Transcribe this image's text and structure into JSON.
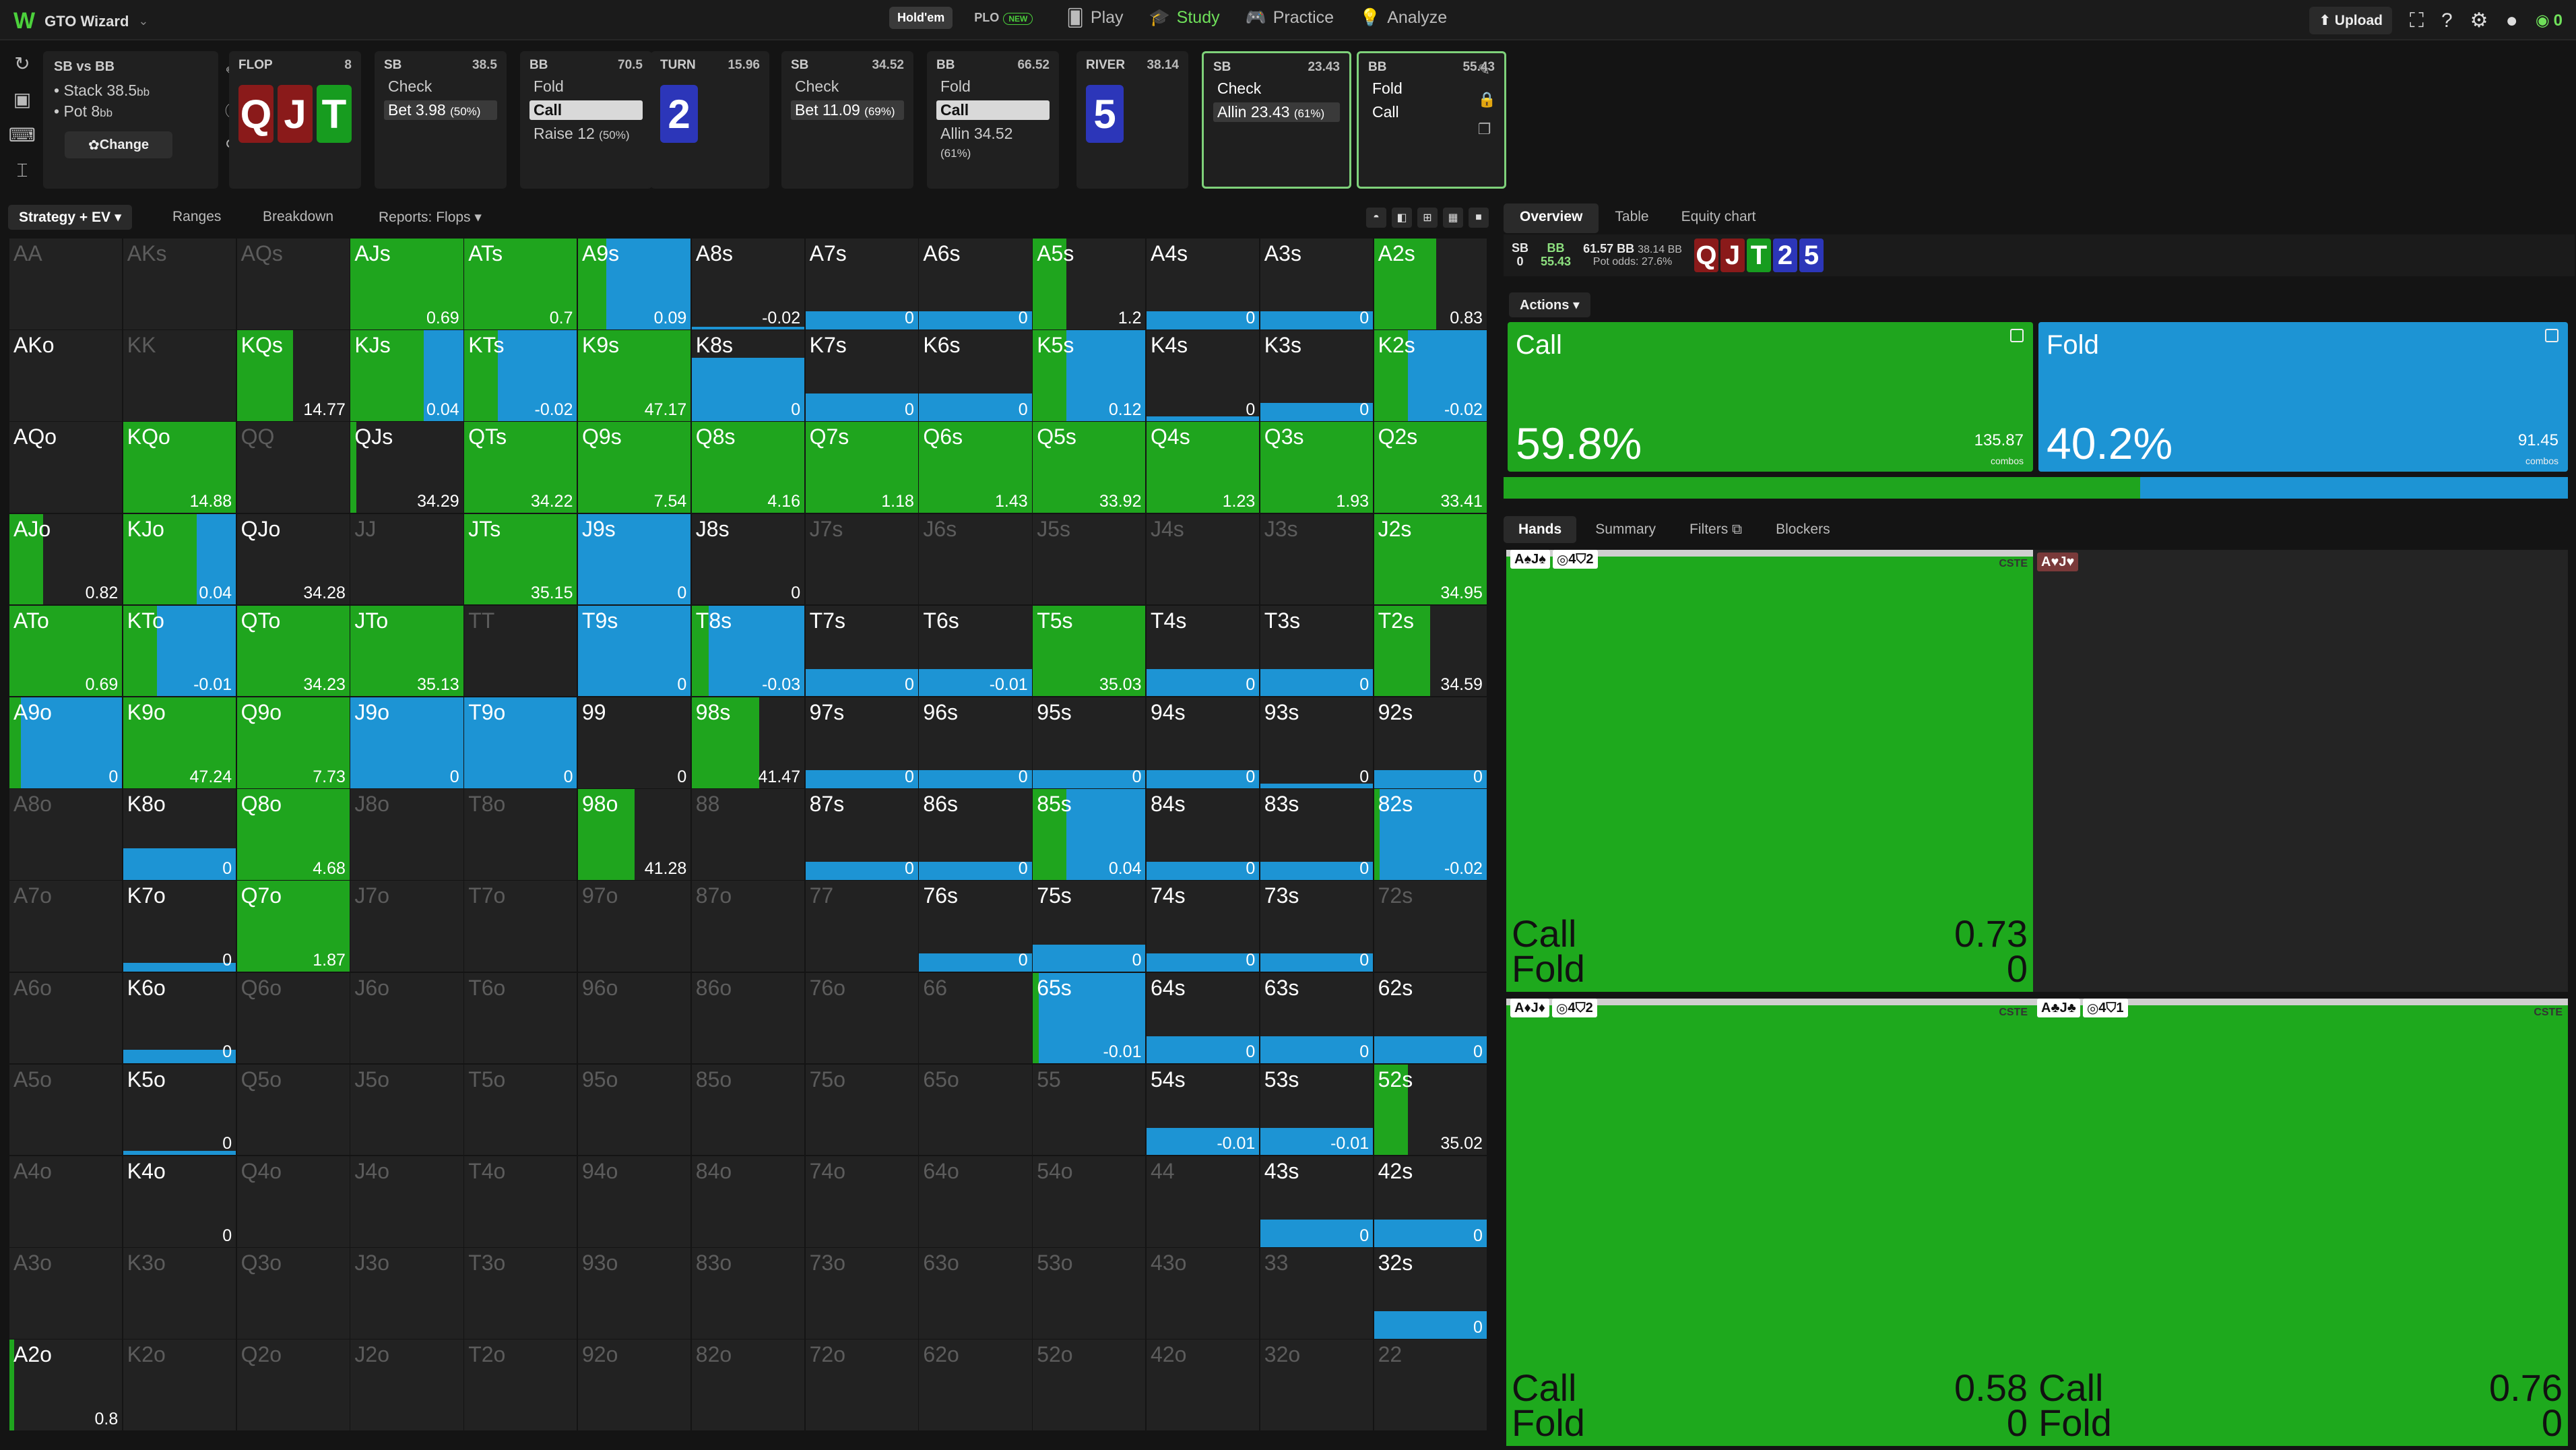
{
  "app": {
    "name": "GTO Wizard"
  },
  "nav": {
    "holdem": "Hold'em",
    "plo": "PLO",
    "plo_badge": "NEW",
    "play": "Play",
    "study": "Study",
    "practice": "Practice",
    "analyze": "Analyze",
    "upload": "Upload",
    "credits": "0"
  },
  "spot": {
    "title": "SB vs BB",
    "stack": "• Stack 38.5",
    "stack_unit": "bb",
    "pot": "• Pot 8",
    "pot_unit": "bb",
    "change": "Change"
  },
  "line": [
    {
      "id": "flop",
      "street": "FLOP",
      "value": "8",
      "cards": [
        {
          "r": "Q",
          "c": "red"
        },
        {
          "r": "J",
          "c": "red"
        },
        {
          "r": "T",
          "c": "grn"
        }
      ]
    },
    {
      "id": "sb1",
      "player": "SB",
      "value": "38.5",
      "opts": [
        {
          "t": "Check",
          "p": "",
          "s": ""
        },
        {
          "t": "Bet 3.98",
          "p": "(50%)",
          "s": "selw"
        }
      ]
    },
    {
      "id": "bb1",
      "player": "BB",
      "value": "70.5",
      "opts": [
        {
          "t": "Fold",
          "p": "",
          "s": ""
        },
        {
          "t": "Call",
          "p": "",
          "s": "sel"
        },
        {
          "t": "Raise 12",
          "p": "(50%)",
          "s": ""
        }
      ]
    },
    {
      "id": "turn",
      "street": "TURN",
      "value": "15.96",
      "cards": [
        {
          "r": "2",
          "c": "blu"
        }
      ]
    },
    {
      "id": "sb2",
      "player": "SB",
      "value": "34.52",
      "opts": [
        {
          "t": "Check",
          "p": "",
          "s": ""
        },
        {
          "t": "Bet 11.09",
          "p": "(69%)",
          "s": "selw"
        }
      ]
    },
    {
      "id": "bb2",
      "player": "BB",
      "value": "66.52",
      "opts": [
        {
          "t": "Fold",
          "p": "",
          "s": ""
        },
        {
          "t": "Call",
          "p": "",
          "s": "sel"
        },
        {
          "t": "Allin 34.52",
          "p": "(61%)",
          "s": ""
        }
      ]
    },
    {
      "id": "river",
      "street": "RIVER",
      "value": "38.14",
      "cards": [
        {
          "r": "5",
          "c": "blu"
        }
      ]
    },
    {
      "id": "sb3",
      "player": "SB",
      "value": "23.43",
      "opts": [
        {
          "t": "Check",
          "p": "",
          "s": ""
        },
        {
          "t": "Allin 23.43",
          "p": "(61%)",
          "s": "selw"
        }
      ]
    },
    {
      "id": "bb3",
      "player": "BB",
      "value": "55.43",
      "opts": [
        {
          "t": "Fold",
          "p": "",
          "s": ""
        },
        {
          "t": "Call",
          "p": "",
          "s": ""
        }
      ]
    }
  ],
  "left_tabs": {
    "strategy": "Strategy + EV",
    "ranges": "Ranges",
    "breakdown": "Breakdown",
    "reports": "Reports: Flops"
  },
  "colors": {
    "call": "#1fa51e",
    "fold": "#1d94d4",
    "cell": "#222222"
  },
  "matrix": {
    "ranks": [
      "A",
      "K",
      "Q",
      "J",
      "T",
      "9",
      "8",
      "7",
      "6",
      "5",
      "4",
      "3",
      "2"
    ],
    "cells": {
      "AJs": {
        "c": 1,
        "ev": "0.69"
      },
      "ATs": {
        "c": 1,
        "ev": "0.7"
      },
      "A9s": {
        "c": 0.25,
        "f": 0.75,
        "ev": "0.09"
      },
      "A8s": {
        "f": 0.03,
        "ev": "-0.02"
      },
      "A7s": {
        "f": 0.2,
        "ev": "0"
      },
      "A6s": {
        "f": 0.2,
        "ev": "0"
      },
      "A5s": {
        "c": 0.3,
        "ev": "1.2"
      },
      "A4s": {
        "f": 0.2,
        "ev": "0"
      },
      "A3s": {
        "f": 0.2,
        "ev": "0"
      },
      "A2s": {
        "c": 0.55,
        "ev": "0.83"
      },
      "KQs": {
        "c": 0.5,
        "ev": "14.77"
      },
      "KJs": {
        "c": 0.65,
        "f": 0.35,
        "ev": "0.04"
      },
      "KTs": {
        "c": 0.3,
        "f": 0.7,
        "ev": "-0.02"
      },
      "K9s": {
        "c": 1,
        "ev": "47.17"
      },
      "K8s": {
        "f": 0.7,
        "ev": "0"
      },
      "K7s": {
        "f": 0.3,
        "ev": "0"
      },
      "K6s": {
        "f": 0.3,
        "ev": "0"
      },
      "K5s": {
        "c": 0.3,
        "f": 0.12,
        "ev": "0.12"
      },
      "K4s": {
        "f": 0.05,
        "ev": "0"
      },
      "K3s": {
        "f": 0.2,
        "ev": "0"
      },
      "K2s": {
        "c": 0.3,
        "f": 0.7,
        "ev": "-0.02"
      },
      "AKo": {},
      "AQo": {},
      "KQo": {
        "c": 1,
        "ev": "14.88"
      },
      "QJs": {
        "c": 0.05,
        "ev": "34.29"
      },
      "QTs": {
        "c": 1,
        "ev": "34.22"
      },
      "Q9s": {
        "c": 1,
        "ev": "7.54"
      },
      "Q8s": {
        "c": 1,
        "ev": "4.16"
      },
      "Q7s": {
        "c": 1,
        "ev": "1.18"
      },
      "Q6s": {
        "c": 1,
        "ev": "1.43"
      },
      "Q5s": {
        "c": 1,
        "ev": "33.92"
      },
      "Q4s": {
        "c": 1,
        "ev": "1.23"
      },
      "Q3s": {
        "c": 1,
        "ev": "1.93"
      },
      "Q2s": {
        "c": 1,
        "ev": "33.41"
      },
      "AJo": {
        "c": 0.3,
        "ev": "0.82"
      },
      "KJo": {
        "c": 0.65,
        "f": 0.35,
        "ev": "0.04"
      },
      "QJo": {
        "c": 0,
        "ev": "34.28"
      },
      "JTs": {
        "c": 1,
        "ev": "35.15"
      },
      "J9s": {
        "f": 1,
        "ev": "0"
      },
      "J8s": {
        "ev": "0"
      },
      "J2s": {
        "c": 1,
        "ev": "34.95"
      },
      "ATo": {
        "c": 1,
        "ev": "0.69"
      },
      "KTo": {
        "c": 0.3,
        "f": 0.7,
        "ev": "-0.01"
      },
      "QTo": {
        "c": 1,
        "ev": "34.23"
      },
      "JTo": {
        "c": 1,
        "ev": "35.13"
      },
      "T9s": {
        "f": 1,
        "ev": "0"
      },
      "T8s": {
        "c": 0.15,
        "f": 0.35,
        "ev": "-0.03"
      },
      "T7s": {
        "f": 0.3,
        "ev": "0"
      },
      "T6s": {
        "f": 0.3,
        "ev": "-0.01"
      },
      "T5s": {
        "c": 1,
        "ev": "35.03"
      },
      "T4s": {
        "f": 0.3,
        "ev": "0"
      },
      "T3s": {
        "f": 0.3,
        "ev": "0"
      },
      "T2s": {
        "c": 0.5,
        "ev": "34.59"
      },
      "A9o": {
        "c": 0.1,
        "f": 0.6,
        "ev": "0"
      },
      "K9o": {
        "c": 1,
        "ev": "47.24"
      },
      "Q9o": {
        "c": 1,
        "ev": "7.73"
      },
      "J9o": {
        "f": 1,
        "ev": "0"
      },
      "T9o": {
        "f": 1,
        "ev": "0"
      },
      "99": {
        "ev": "0"
      },
      "98s": {
        "c": 0.6,
        "ev": "41.47"
      },
      "97s": {
        "f": 0.2,
        "ev": "0"
      },
      "96s": {
        "f": 0.2,
        "ev": "0"
      },
      "95s": {
        "f": 0.2,
        "ev": "0"
      },
      "94s": {
        "f": 0.2,
        "ev": "0"
      },
      "93s": {
        "f": 0.05,
        "ev": "0"
      },
      "92s": {
        "f": 0.2,
        "ev": "0"
      },
      "K8o": {
        "f": 0.35,
        "ev": "0"
      },
      "Q8o": {
        "c": 1,
        "ev": "4.68"
      },
      "98o": {
        "c": 0.5,
        "ev": "41.28"
      },
      "87s": {
        "f": 0.2,
        "ev": "0"
      },
      "86s": {
        "f": 0.2,
        "ev": "0"
      },
      "85s": {
        "c": 0.3,
        "f": 0.3,
        "ev": "0.04"
      },
      "84s": {
        "f": 0.2,
        "ev": "0"
      },
      "83s": {
        "f": 0.2,
        "ev": "0"
      },
      "82s": {
        "c": 0.05,
        "f": 0.2,
        "ev": "-0.02"
      },
      "K7o": {
        "f": 0.1,
        "ev": "0"
      },
      "Q7o": {
        "c": 1,
        "ev": "1.87"
      },
      "76s": {
        "f": 0.2,
        "ev": "0"
      },
      "75s": {
        "f": 0.3,
        "ev": "0"
      },
      "74s": {
        "f": 0.2,
        "ev": "0"
      },
      "73s": {
        "f": 0.2,
        "ev": "0"
      },
      "K6o": {
        "f": 0.15,
        "ev": "0"
      },
      "65s": {
        "c": 0.05,
        "f": 0.3,
        "ev": "-0.01"
      },
      "64s": {
        "f": 0.3,
        "ev": "0"
      },
      "63s": {
        "f": 0.3,
        "ev": "0"
      },
      "62s": {
        "f": 0.3,
        "ev": "0"
      },
      "K5o": {
        "f": 0.05,
        "ev": "0"
      },
      "54s": {
        "f": 0.3,
        "ev": "-0.01"
      },
      "53s": {
        "f": 0.3,
        "ev": "-0.01"
      },
      "52s": {
        "c": 0.3,
        "ev": "35.02"
      },
      "K4o": {
        "ev": "0"
      },
      "43s": {
        "f": 0.3,
        "ev": "0"
      },
      "42s": {
        "f": 0.3,
        "ev": "0"
      },
      "32s": {
        "f": 0.3,
        "ev": "0"
      },
      "A2o": {
        "c": 0.04,
        "ev": "0.8"
      }
    }
  },
  "right_tabs": {
    "overview": "Overview",
    "table": "Table",
    "equity": "Equity chart"
  },
  "info": {
    "sb_label": "SB",
    "sb_val": "0",
    "bb_label": "BB",
    "bb_val": "55.43",
    "pot": "61.57 BB",
    "tocall": "38.14 BB",
    "potodds_label": "Pot odds:",
    "potodds": "27.6%",
    "board": [
      {
        "r": "Q",
        "c": "red"
      },
      {
        "r": "J",
        "c": "red"
      },
      {
        "r": "T",
        "c": "grn"
      },
      {
        "r": "2",
        "c": "blu"
      },
      {
        "r": "5",
        "c": "blu"
      }
    ]
  },
  "actions_label": "Actions",
  "summary": {
    "call": {
      "name": "Call",
      "pct": "59.8%",
      "combos": "135.87",
      "combos_label": "combos",
      "frac": 0.598
    },
    "fold": {
      "name": "Fold",
      "pct": "40.2%",
      "combos": "91.45",
      "combos_label": "combos"
    }
  },
  "hand_tabs": {
    "hands": "Hands",
    "summary": "Summary",
    "filters": "Filters",
    "blockers": "Blockers"
  },
  "hands": [
    {
      "cards": "A♠J♠",
      "tag1": "4",
      "tag2": "2",
      "cs": "CSTE",
      "call": "Call",
      "call_v": "0.73",
      "fold": "Fold",
      "fold_v": "0",
      "empty": false
    },
    {
      "cards": "A♥J♥",
      "empty": true
    },
    {
      "cards": "A♦J♦",
      "tag1": "4",
      "tag2": "2",
      "cs": "CSTE",
      "call": "Call",
      "call_v": "0.58",
      "fold": "Fold",
      "fold_v": "0",
      "empty": false
    },
    {
      "cards": "A♣J♣",
      "tag1": "4",
      "tag2": "1",
      "cs": "CSTE",
      "call": "Call",
      "call_v": "0.76",
      "fold": "Fold",
      "fold_v": "0",
      "empty": false
    }
  ]
}
